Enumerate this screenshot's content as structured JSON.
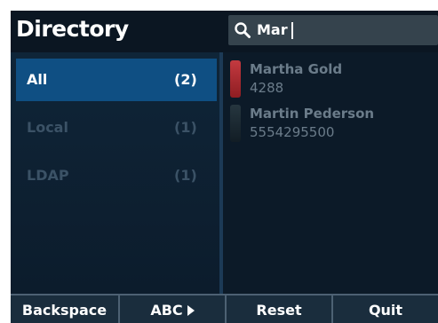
{
  "header": {
    "title": "Directory",
    "search": {
      "value": "Mar"
    }
  },
  "folders": [
    {
      "name": "All",
      "count": "(2)",
      "selected": true
    },
    {
      "name": "Local",
      "count": "(1)",
      "selected": false
    },
    {
      "name": "LDAP",
      "count": "(1)",
      "selected": false
    }
  ],
  "contacts": [
    {
      "name": "Martha Gold",
      "number": "4288",
      "status_color": "#b3262c"
    },
    {
      "name": "Martin Pederson",
      "number": "5554295500",
      "status_color": "#1b2a35"
    }
  ],
  "softkeys": [
    {
      "label": "Backspace"
    },
    {
      "label": "ABC"
    },
    {
      "label": "Reset"
    },
    {
      "label": "Quit"
    }
  ],
  "colors": {
    "background": "#0c1a28",
    "selected_folder": "#0f4f83",
    "search_box": "#35434d",
    "softkey_bar": "#1a2d3d"
  }
}
